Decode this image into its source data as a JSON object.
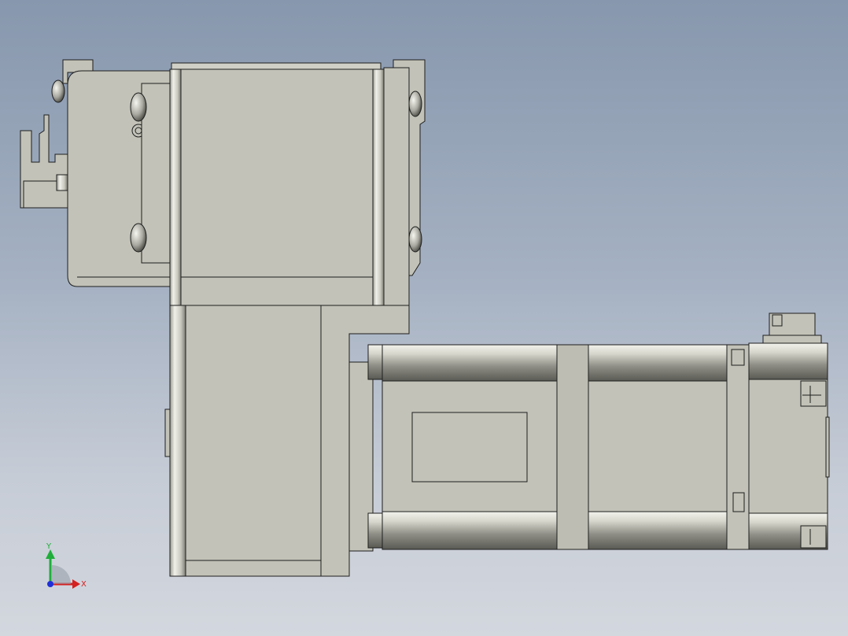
{
  "viewport": {
    "background_top": "#8797ad",
    "background_bottom": "#d3d7de",
    "part_fill": "#c2c2b8",
    "part_edge": "#1e1e1e"
  },
  "triad": {
    "x_label": "X",
    "y_label": "Y",
    "x_color": "#d42020",
    "y_color": "#1fae3a",
    "z_color": "#2030d8"
  }
}
